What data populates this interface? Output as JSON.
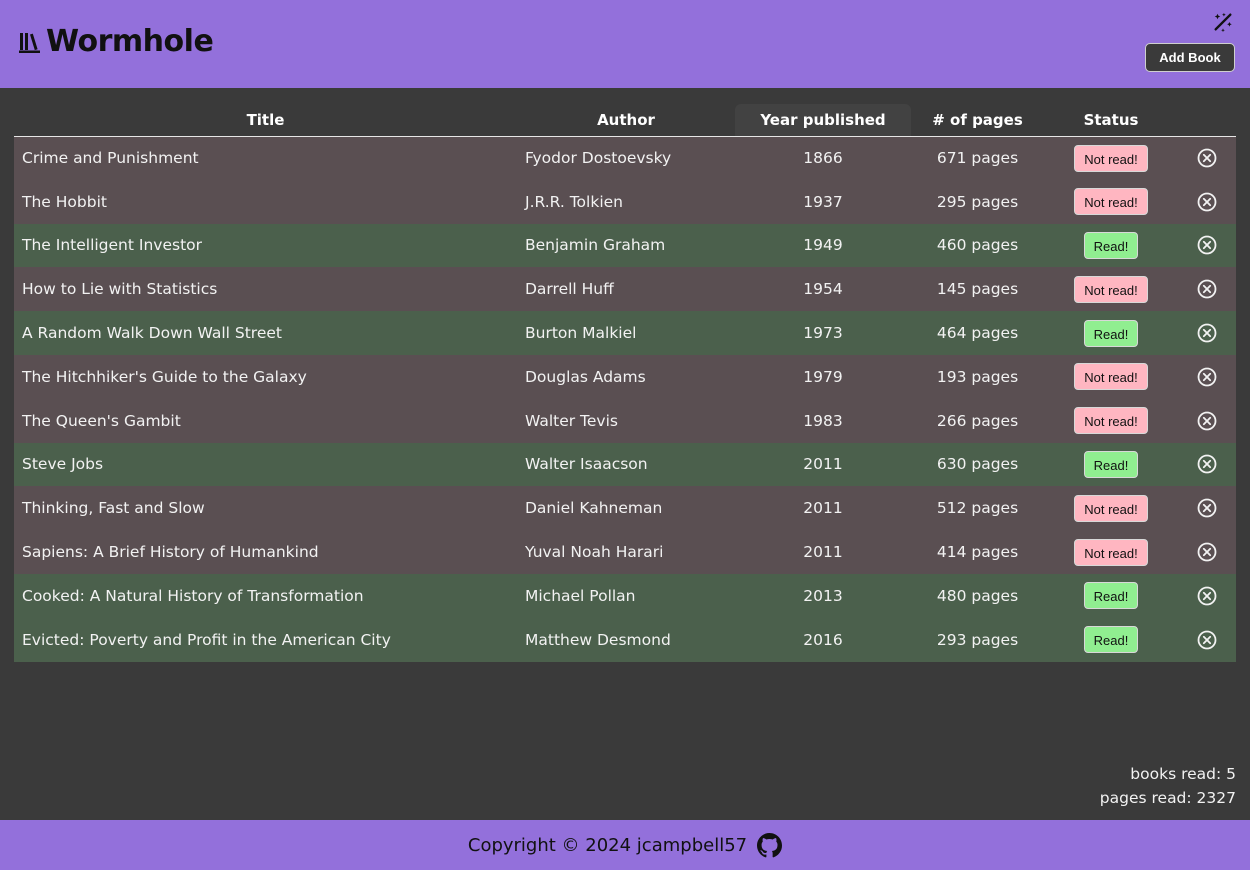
{
  "header": {
    "title": "Wormhole",
    "add_book_label": "Add Book",
    "brand_icon": "books-icon",
    "theme_icon": "theme-toggle-icon"
  },
  "table": {
    "columns": {
      "title": "Title",
      "author": "Author",
      "year": "Year published",
      "pages": "# of pages",
      "status": "Status"
    },
    "rows": [
      {
        "title": "Crime and Punishment",
        "author": "Fyodor Dostoevsky",
        "year": "1866",
        "pages": "671 pages",
        "status": "Not read!",
        "read": false
      },
      {
        "title": "The Hobbit",
        "author": "J.R.R. Tolkien",
        "year": "1937",
        "pages": "295 pages",
        "status": "Not read!",
        "read": false
      },
      {
        "title": "The Intelligent Investor",
        "author": "Benjamin Graham",
        "year": "1949",
        "pages": "460 pages",
        "status": "Read!",
        "read": true
      },
      {
        "title": "How to Lie with Statistics",
        "author": "Darrell Huff",
        "year": "1954",
        "pages": "145 pages",
        "status": "Not read!",
        "read": false
      },
      {
        "title": "A Random Walk Down Wall Street",
        "author": "Burton Malkiel",
        "year": "1973",
        "pages": "464 pages",
        "status": "Read!",
        "read": true
      },
      {
        "title": "The Hitchhiker's Guide to the Galaxy",
        "author": "Douglas Adams",
        "year": "1979",
        "pages": "193 pages",
        "status": "Not read!",
        "read": false
      },
      {
        "title": "The Queen's Gambit",
        "author": "Walter Tevis",
        "year": "1983",
        "pages": "266 pages",
        "status": "Not read!",
        "read": false
      },
      {
        "title": "Steve Jobs",
        "author": "Walter Isaacson",
        "year": "2011",
        "pages": "630 pages",
        "status": "Read!",
        "read": true
      },
      {
        "title": "Thinking, Fast and Slow",
        "author": "Daniel Kahneman",
        "year": "2011",
        "pages": "512 pages",
        "status": "Not read!",
        "read": false
      },
      {
        "title": "Sapiens: A Brief History of Humankind",
        "author": "Yuval Noah Harari",
        "year": "2011",
        "pages": "414 pages",
        "status": "Not read!",
        "read": false
      },
      {
        "title": "Cooked: A Natural History of Transformation",
        "author": "Michael Pollan",
        "year": "2013",
        "pages": "480 pages",
        "status": "Read!",
        "read": true
      },
      {
        "title": "Evicted: Poverty and Profit in the American City",
        "author": "Matthew Desmond",
        "year": "2016",
        "pages": "293 pages",
        "status": "Read!",
        "read": true
      }
    ]
  },
  "stats": {
    "books_read": "books read: 5",
    "pages_read": "pages read: 2327"
  },
  "footer": {
    "copyright": "Copyright © 2024 jcampbell57",
    "github_icon": "github-icon"
  },
  "colors": {
    "brand": "#9370db",
    "background": "#3a3a3a",
    "row_unread": "#5a4f52",
    "row_read": "#4b604c",
    "badge_unread": "#ffb6c1",
    "badge_read": "#90ee90"
  }
}
